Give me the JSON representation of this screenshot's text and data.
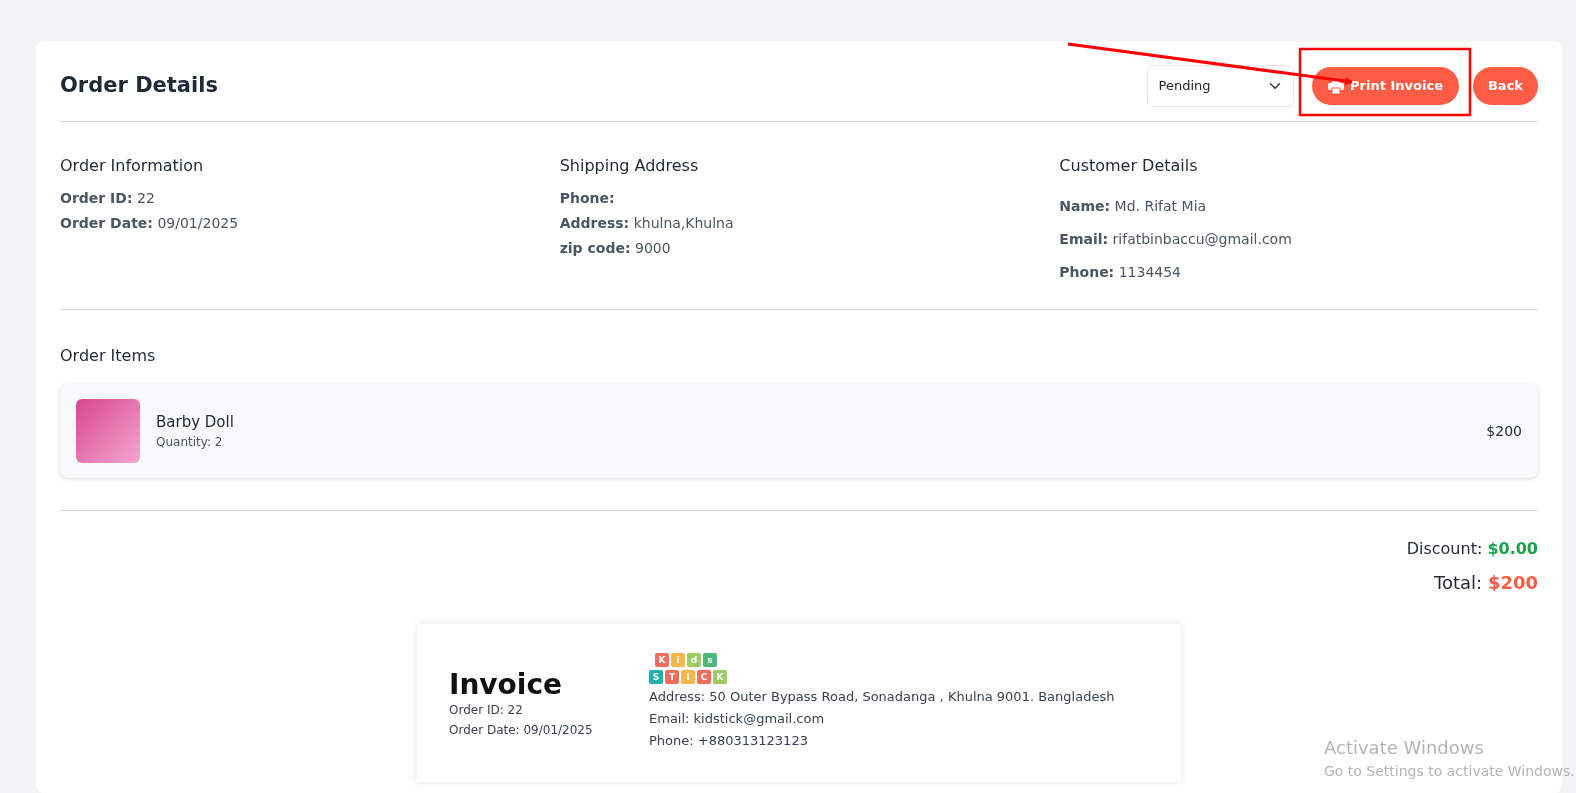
{
  "header": {
    "title": "Order Details",
    "status_select": {
      "value": "Pending"
    },
    "buttons": [
      {
        "kind": "print",
        "label": "Print Invoice"
      },
      {
        "kind": "plain",
        "label": "Back"
      }
    ]
  },
  "info_sections": [
    {
      "title": "Order Information",
      "kind": "compact",
      "fields": [
        {
          "label": "Order ID:",
          "value": "22"
        },
        {
          "label": "Order Date:",
          "value": "09/01/2025"
        }
      ]
    },
    {
      "title": "Shipping Address",
      "kind": "compact",
      "fields": [
        {
          "label": "Phone:"
        },
        {
          "label": "Address:",
          "value": "khulna,Khulna"
        },
        {
          "label": "zip code:",
          "value": "9000"
        }
      ]
    },
    {
      "title": "Customer Details",
      "kind": "spaced",
      "fields": [
        {
          "label": "Name:",
          "value": "Md. Rifat Mia"
        },
        {
          "label": "Email:",
          "value": "rifatbinbaccu@gmail.com"
        },
        {
          "label": "Phone:",
          "value": "1134454"
        }
      ]
    }
  ],
  "order_items": {
    "title": "Order Items",
    "items": [
      {
        "name": "Barby Doll",
        "quantity": "Quantity: 2",
        "price": "$200"
      }
    ]
  },
  "totals": [
    {
      "label": "Discount:",
      "value": "$0.00",
      "color": "#16a34a"
    },
    {
      "label": "Total:",
      "value": "$200",
      "color": "#fe5c45"
    }
  ],
  "invoice": {
    "title": "Invoice",
    "order_id": "Order ID: 22",
    "order_date": "Order Date: 09/01/2025",
    "logo_rows": [
      [
        {
          "letter": "K",
          "color": "#f26d5b"
        },
        {
          "letter": "i",
          "color": "#f7b84b"
        },
        {
          "letter": "d",
          "color": "#9ccc65"
        },
        {
          "letter": "s",
          "color": "#4cb97a"
        }
      ],
      [
        {
          "letter": "S",
          "color": "#20b2aa"
        },
        {
          "letter": "T",
          "color": "#f26d5b"
        },
        {
          "letter": "I",
          "color": "#f7b84b"
        },
        {
          "letter": "C",
          "color": "#f26d5b"
        },
        {
          "letter": "K",
          "color": "#9ccc65"
        }
      ]
    ],
    "company_lines": [
      "Address: 50 Outer Bypass Road, Sonadanga , Khulna 9001. Bangladesh",
      "Email: kidstick@gmail.com",
      "Phone: +880313123123"
    ]
  },
  "os_notice": {
    "title": "Activate Windows",
    "subtitle": "Go to Settings to activate Windows."
  }
}
